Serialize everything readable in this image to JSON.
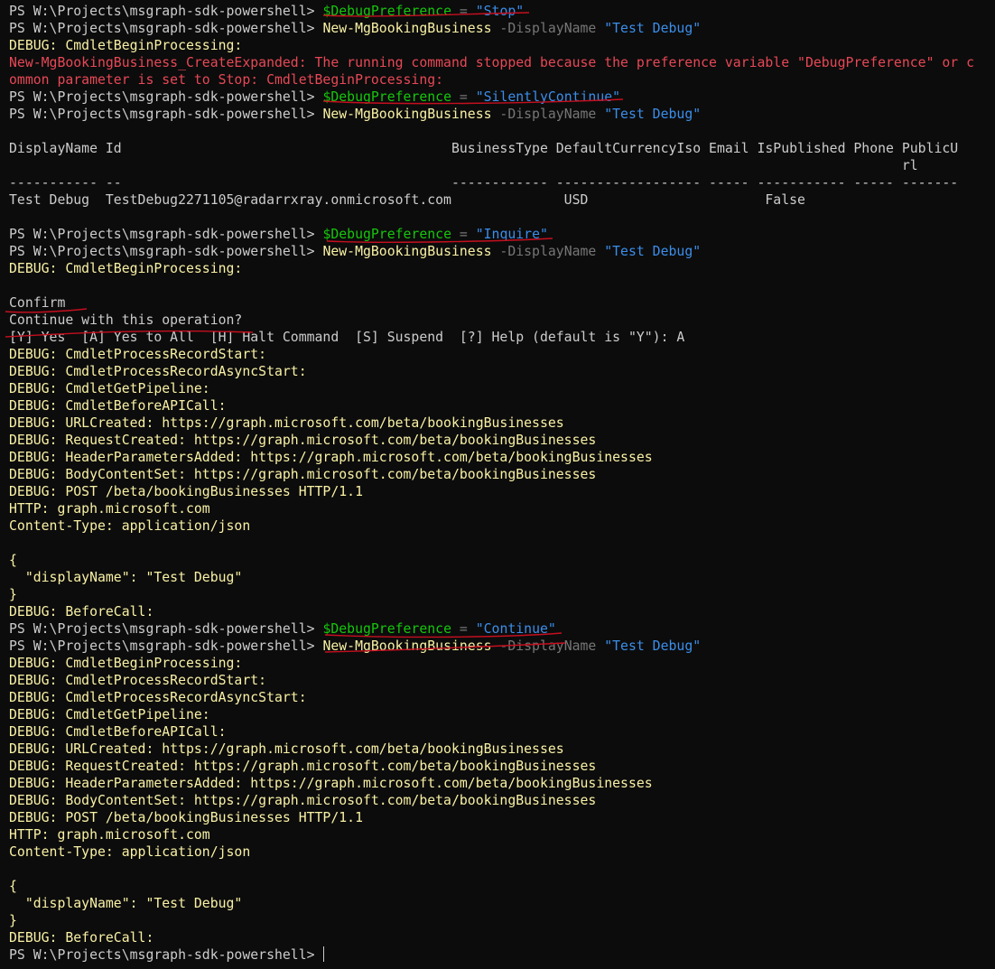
{
  "terminal": {
    "colors": {
      "background": "#0c0c0c",
      "foreground": "#cccccc",
      "variable": "#16c60c",
      "operator": "#767676",
      "string": "#3b8eea",
      "command": "#f9f1a5",
      "parameter": "#767676",
      "debug": "#f9f1a5",
      "error": "#e74856",
      "annotation": "#c50f1f"
    },
    "lines": [
      [
        {
          "t": "PS W:\\Projects\\msgraph-sdk-powershell> ",
          "c": "prompt"
        },
        {
          "t": "$DebugPreference",
          "c": "var"
        },
        {
          "t": " = ",
          "c": "op"
        },
        {
          "t": "\"Stop\"",
          "c": "str"
        }
      ],
      [
        {
          "t": "PS W:\\Projects\\msgraph-sdk-powershell> ",
          "c": "prompt"
        },
        {
          "t": "New-MgBookingBusiness",
          "c": "cmd"
        },
        {
          "t": " -DisplayName",
          "c": "param"
        },
        {
          "t": " \"Test Debug\"",
          "c": "str"
        }
      ],
      [
        {
          "t": "DEBUG: CmdletBeginProcessing:",
          "c": "debug"
        }
      ],
      [
        {
          "t": "New-MgBookingBusiness_CreateExpanded: The running command stopped because the preference variable \"DebugPreference\" or c",
          "c": "error"
        }
      ],
      [
        {
          "t": "ommon parameter is set to Stop: CmdletBeginProcessing:",
          "c": "error"
        }
      ],
      [
        {
          "t": "PS W:\\Projects\\msgraph-sdk-powershell> ",
          "c": "prompt"
        },
        {
          "t": "$DebugPreference",
          "c": "var"
        },
        {
          "t": " = ",
          "c": "op"
        },
        {
          "t": "\"SilentlyContinue\"",
          "c": "str"
        }
      ],
      [
        {
          "t": "PS W:\\Projects\\msgraph-sdk-powershell> ",
          "c": "prompt"
        },
        {
          "t": "New-MgBookingBusiness",
          "c": "cmd"
        },
        {
          "t": " -DisplayName",
          "c": "param"
        },
        {
          "t": " \"Test Debug\"",
          "c": "str"
        }
      ],
      [],
      [
        {
          "t": "DisplayName Id                                         BusinessType DefaultCurrencyIso Email IsPublished Phone PublicU",
          "c": "plain"
        }
      ],
      [
        {
          "t": "                                                                                                               rl",
          "c": "plain"
        }
      ],
      [
        {
          "t": "----------- --                                         ------------ ------------------ ----- ----------- ----- -------",
          "c": "plain"
        }
      ],
      [
        {
          "t": "Test Debug  TestDebug2271105@radarrxray.onmicrosoft.com              USD                      False",
          "c": "plain"
        }
      ],
      [],
      [
        {
          "t": "PS W:\\Projects\\msgraph-sdk-powershell> ",
          "c": "prompt"
        },
        {
          "t": "$DebugPreference",
          "c": "var"
        },
        {
          "t": " = ",
          "c": "op"
        },
        {
          "t": "\"Inquire\"",
          "c": "str"
        }
      ],
      [
        {
          "t": "PS W:\\Projects\\msgraph-sdk-powershell> ",
          "c": "prompt"
        },
        {
          "t": "New-MgBookingBusiness",
          "c": "cmd"
        },
        {
          "t": " -DisplayName",
          "c": "param"
        },
        {
          "t": " \"Test Debug\"",
          "c": "str"
        }
      ],
      [
        {
          "t": "DEBUG: CmdletBeginProcessing:",
          "c": "debug"
        }
      ],
      [],
      [
        {
          "t": "Confirm",
          "c": "plain"
        }
      ],
      [
        {
          "t": "Continue with this operation?",
          "c": "plain"
        }
      ],
      [
        {
          "t": "[Y] Yes  [A] Yes to All  [H] Halt Command  [S] Suspend  [?] Help (default is \"Y\"): A",
          "c": "plain"
        }
      ],
      [
        {
          "t": "DEBUG: CmdletProcessRecordStart:",
          "c": "debug"
        }
      ],
      [
        {
          "t": "DEBUG: CmdletProcessRecordAsyncStart:",
          "c": "debug"
        }
      ],
      [
        {
          "t": "DEBUG: CmdletGetPipeline:",
          "c": "debug"
        }
      ],
      [
        {
          "t": "DEBUG: CmdletBeforeAPICall:",
          "c": "debug"
        }
      ],
      [
        {
          "t": "DEBUG: URLCreated: https://graph.microsoft.com/beta/bookingBusinesses",
          "c": "debug"
        }
      ],
      [
        {
          "t": "DEBUG: RequestCreated: https://graph.microsoft.com/beta/bookingBusinesses",
          "c": "debug"
        }
      ],
      [
        {
          "t": "DEBUG: HeaderParametersAdded: https://graph.microsoft.com/beta/bookingBusinesses",
          "c": "debug"
        }
      ],
      [
        {
          "t": "DEBUG: BodyContentSet: https://graph.microsoft.com/beta/bookingBusinesses",
          "c": "debug"
        }
      ],
      [
        {
          "t": "DEBUG: POST /beta/bookingBusinesses HTTP/1.1",
          "c": "debug"
        }
      ],
      [
        {
          "t": "HTTP: graph.microsoft.com",
          "c": "debug"
        }
      ],
      [
        {
          "t": "Content-Type: application/json",
          "c": "debug"
        }
      ],
      [],
      [
        {
          "t": "{",
          "c": "debug"
        }
      ],
      [
        {
          "t": "  \"displayName\": \"Test Debug\"",
          "c": "debug"
        }
      ],
      [
        {
          "t": "}",
          "c": "debug"
        }
      ],
      [
        {
          "t": "DEBUG: BeforeCall:",
          "c": "debug"
        }
      ],
      [
        {
          "t": "PS W:\\Projects\\msgraph-sdk-powershell> ",
          "c": "prompt"
        },
        {
          "t": "$DebugPreference",
          "c": "var"
        },
        {
          "t": " = ",
          "c": "op"
        },
        {
          "t": "\"Continue\"",
          "c": "str"
        }
      ],
      [
        {
          "t": "PS W:\\Projects\\msgraph-sdk-powershell> ",
          "c": "prompt"
        },
        {
          "t": "New-MgBookingBusiness",
          "c": "cmd"
        },
        {
          "t": " -DisplayName",
          "c": "param"
        },
        {
          "t": " \"Test Debug\"",
          "c": "str"
        }
      ],
      [
        {
          "t": "DEBUG: CmdletBeginProcessing:",
          "c": "debug"
        }
      ],
      [
        {
          "t": "DEBUG: CmdletProcessRecordStart:",
          "c": "debug"
        }
      ],
      [
        {
          "t": "DEBUG: CmdletProcessRecordAsyncStart:",
          "c": "debug"
        }
      ],
      [
        {
          "t": "DEBUG: CmdletGetPipeline:",
          "c": "debug"
        }
      ],
      [
        {
          "t": "DEBUG: CmdletBeforeAPICall:",
          "c": "debug"
        }
      ],
      [
        {
          "t": "DEBUG: URLCreated: https://graph.microsoft.com/beta/bookingBusinesses",
          "c": "debug"
        }
      ],
      [
        {
          "t": "DEBUG: RequestCreated: https://graph.microsoft.com/beta/bookingBusinesses",
          "c": "debug"
        }
      ],
      [
        {
          "t": "DEBUG: HeaderParametersAdded: https://graph.microsoft.com/beta/bookingBusinesses",
          "c": "debug"
        }
      ],
      [
        {
          "t": "DEBUG: BodyContentSet: https://graph.microsoft.com/beta/bookingBusinesses",
          "c": "debug"
        }
      ],
      [
        {
          "t": "DEBUG: POST /beta/bookingBusinesses HTTP/1.1",
          "c": "debug"
        }
      ],
      [
        {
          "t": "HTTP: graph.microsoft.com",
          "c": "debug"
        }
      ],
      [
        {
          "t": "Content-Type: application/json",
          "c": "debug"
        }
      ],
      [],
      [
        {
          "t": "{",
          "c": "debug"
        }
      ],
      [
        {
          "t": "  \"displayName\": \"Test Debug\"",
          "c": "debug"
        }
      ],
      [
        {
          "t": "}",
          "c": "debug"
        }
      ],
      [
        {
          "t": "DEBUG: BeforeCall:",
          "c": "debug"
        }
      ],
      [
        {
          "t": "PS W:\\Projects\\msgraph-sdk-powershell> ",
          "c": "prompt"
        }
      ]
    ]
  }
}
